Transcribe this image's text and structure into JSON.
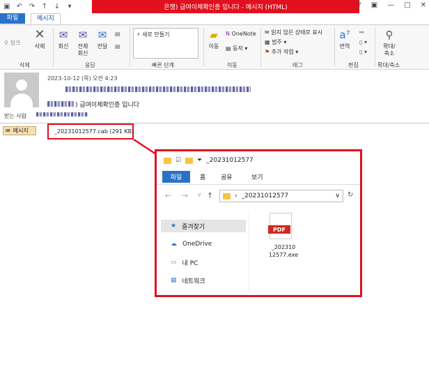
{
  "titlebar": {
    "title": "은행) 급여이체확인증 입니다 - 메시지 (HTML)",
    "qat_icons": [
      "save-icon",
      "undo-icon",
      "redo-icon",
      "up-arrow-icon",
      "down-arrow-icon",
      "customize-icon"
    ],
    "window_controls": [
      "?",
      "▣",
      "—",
      "□",
      "✕"
    ]
  },
  "ribbon_tabs": {
    "file": "파일",
    "message": "메시지"
  },
  "ribbon": {
    "delete_group": {
      "junk": "정크",
      "delete": "삭제",
      "label": "삭제"
    },
    "respond_group": {
      "reply": "회신",
      "reply_all": "전체\n회신",
      "forward": "전달",
      "label": "응답"
    },
    "quick_steps": {
      "new": "새로 만들기",
      "label": "빠른 단계"
    },
    "move_group": {
      "move": "이동",
      "onenote": "OneNote",
      "actions": "동작",
      "label": "이동"
    },
    "tags_group": {
      "unread": "읽지 않은 상태로 표시",
      "categorize": "범주",
      "follow_up": "추가 작업",
      "label": "태그"
    },
    "editing_group": {
      "translate": "번역",
      "label": "편집"
    },
    "zoom_group": {
      "zoom": "확대/\n축소",
      "label": "확대/축소"
    }
  },
  "message": {
    "date": "2023-10-12 (목) 오전 4:23",
    "subject_suffix": ") 급여이체확인증 입니다",
    "recipient_label": "받는 사람",
    "message_tab": "메시지",
    "attachment": "_20231012577.cab (291 KB)"
  },
  "explorer": {
    "title": "_20231012577",
    "tabs": {
      "file": "파일",
      "home": "홈",
      "share": "공유",
      "view": "보기"
    },
    "address": "_20231012577",
    "nav": [
      "즐겨찾기",
      "OneDrive",
      "내 PC",
      "네트워크"
    ],
    "file": {
      "badge": "PDF",
      "name": "_202310\n12577.exe"
    }
  },
  "colors": {
    "highlight_red": "#e0101e",
    "office_blue": "#2a72c8"
  }
}
